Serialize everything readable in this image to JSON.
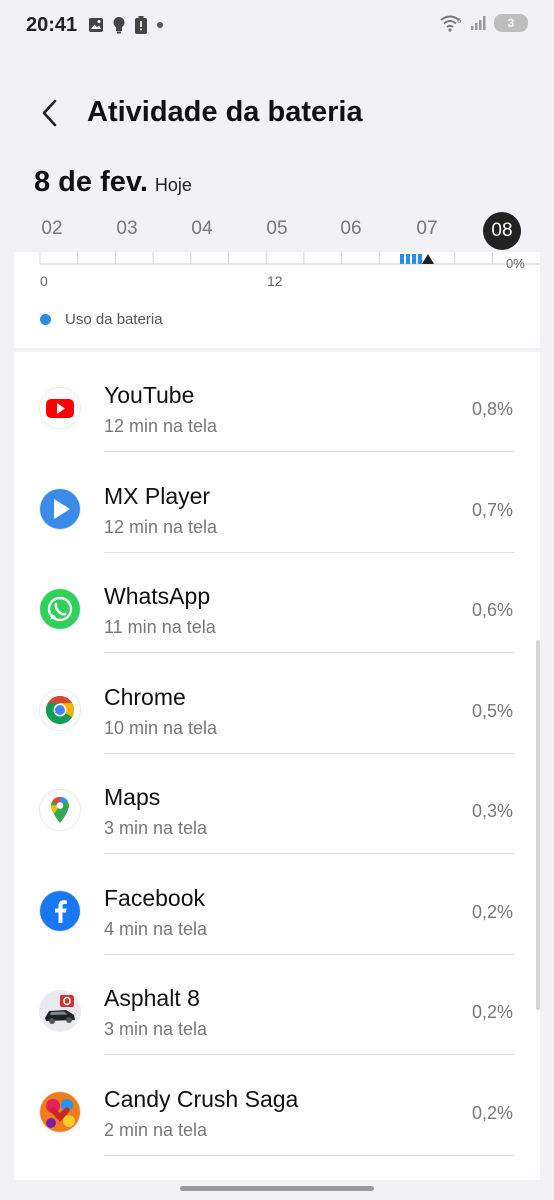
{
  "status_bar": {
    "time": "20:41",
    "left_icons": [
      "gallery-icon",
      "bulb-icon",
      "alert-battery-icon",
      "dot-icon"
    ],
    "right_icons": [
      "wifi-icon",
      "signal-icon"
    ],
    "battery_level": "3"
  },
  "header": {
    "title": "Atividade da bateria"
  },
  "date": {
    "main": "8 de fev.",
    "sub": "Hoje"
  },
  "hours": [
    "02",
    "03",
    "04",
    "05",
    "06",
    "07",
    "08"
  ],
  "selected_hour": "08",
  "chart": {
    "x_tick_labels": [
      "0",
      "12"
    ],
    "right_label": "0%",
    "legend_label": "Uso da bateria",
    "accent_color": "#2b8de6"
  },
  "apps": [
    {
      "name": "YouTube",
      "screen_time": "12 min na tela",
      "percent": "0,8%",
      "icon": "youtube-icon"
    },
    {
      "name": "MX Player",
      "screen_time": "12 min na tela",
      "percent": "0,7%",
      "icon": "mx-player-icon"
    },
    {
      "name": "WhatsApp",
      "screen_time": "11 min na tela",
      "percent": "0,6%",
      "icon": "whatsapp-icon"
    },
    {
      "name": "Chrome",
      "screen_time": "10 min na tela",
      "percent": "0,5%",
      "icon": "chrome-icon"
    },
    {
      "name": "Maps",
      "screen_time": "3 min na tela",
      "percent": "0,3%",
      "icon": "maps-icon"
    },
    {
      "name": "Facebook",
      "screen_time": "4 min na tela",
      "percent": "0,2%",
      "icon": "facebook-icon"
    },
    {
      "name": "Asphalt 8",
      "screen_time": "3 min na tela",
      "percent": "0,2%",
      "icon": "asphalt-icon"
    },
    {
      "name": "Candy Crush Saga",
      "screen_time": "2 min na tela",
      "percent": "0,2%",
      "icon": "candy-crush-icon"
    }
  ]
}
